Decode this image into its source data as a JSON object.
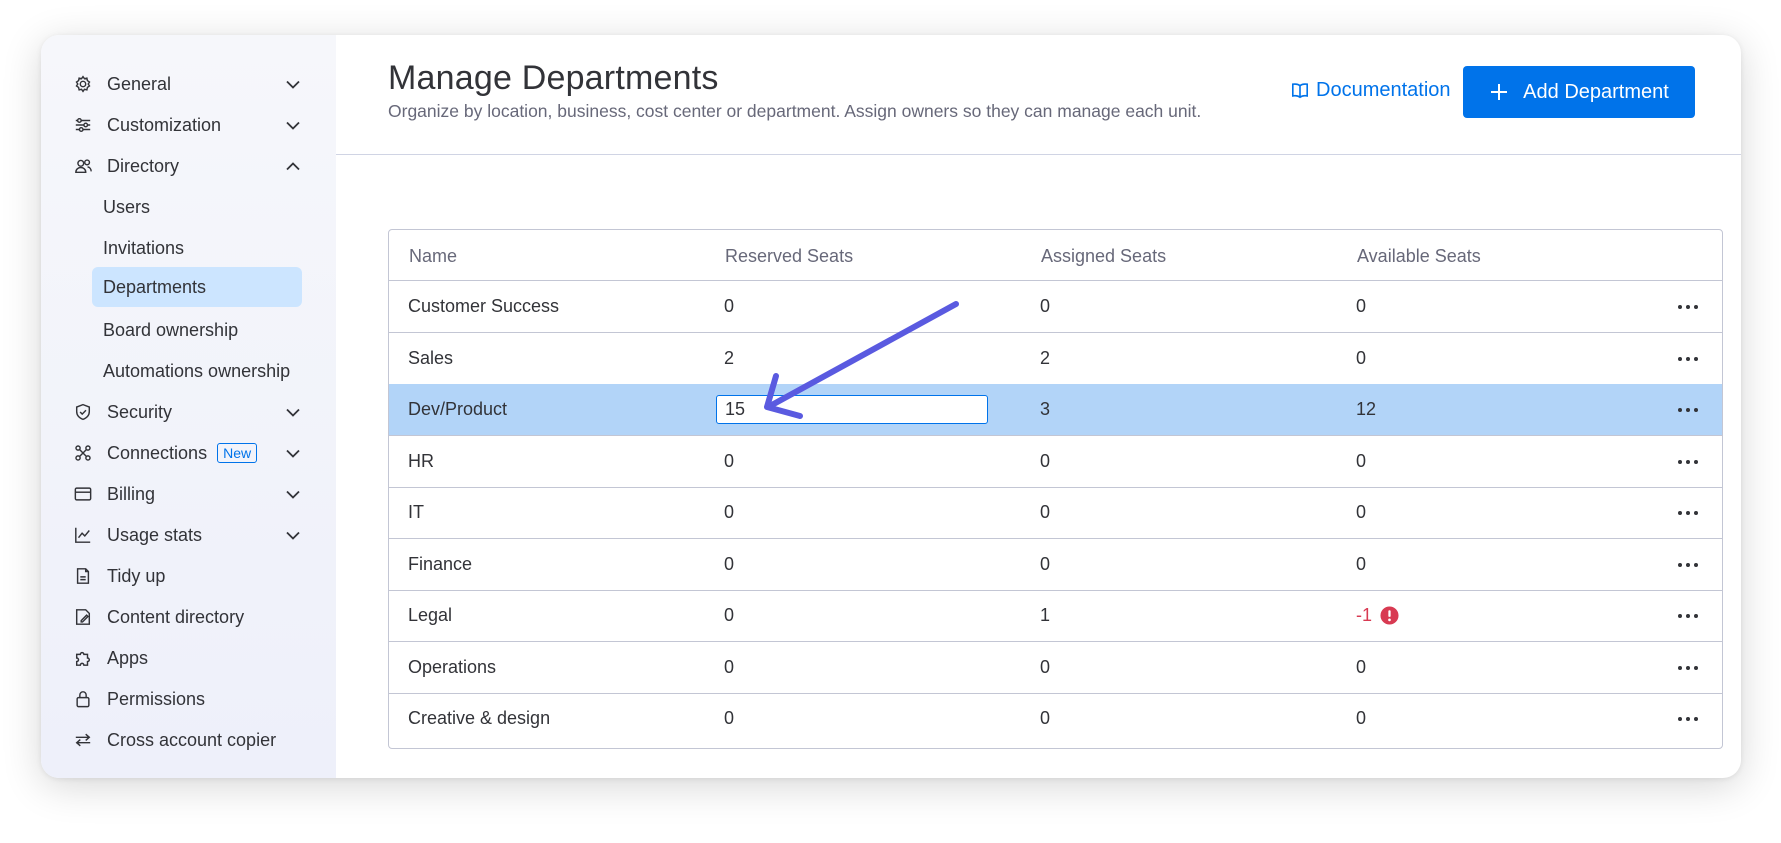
{
  "sidebar": {
    "items": [
      {
        "label": "General",
        "icon": "gear-icon",
        "expand": "down"
      },
      {
        "label": "Customization",
        "icon": "sliders-icon",
        "expand": "down"
      },
      {
        "label": "Directory",
        "icon": "users-icon",
        "expand": "up"
      },
      {
        "label": "Security",
        "icon": "shield-icon",
        "expand": "down"
      },
      {
        "label": "Connections",
        "icon": "connections-icon",
        "expand": "down",
        "badge": "New"
      },
      {
        "label": "Billing",
        "icon": "credit-card-icon",
        "expand": "down"
      },
      {
        "label": "Usage stats",
        "icon": "chart-icon",
        "expand": "down"
      },
      {
        "label": "Tidy up",
        "icon": "broom-icon"
      },
      {
        "label": "Content directory",
        "icon": "content-directory-icon"
      },
      {
        "label": "Apps",
        "icon": "puzzle-icon"
      },
      {
        "label": "Permissions",
        "icon": "lock-icon"
      },
      {
        "label": "Cross account copier",
        "icon": "swap-arrows-icon"
      }
    ],
    "directory_subitems": [
      {
        "label": "Users"
      },
      {
        "label": "Invitations"
      },
      {
        "label": "Departments",
        "active": true
      },
      {
        "label": "Board ownership"
      },
      {
        "label": "Automations ownership"
      }
    ]
  },
  "header": {
    "title": "Manage Departments",
    "subtitle": "Organize by location, business, cost center or department. Assign owners so they can manage each unit.",
    "doc_link": "Documentation",
    "add_button": "Add Department"
  },
  "table": {
    "columns": [
      "Name",
      "Reserved Seats",
      "Assigned Seats",
      "Available Seats"
    ],
    "rows": [
      {
        "name": "Customer Success",
        "reserved": "0",
        "assigned": "0",
        "available": "0"
      },
      {
        "name": "Sales",
        "reserved": "2",
        "assigned": "2",
        "available": "0"
      },
      {
        "name": "Dev/Product",
        "reserved": "15",
        "assigned": "3",
        "available": "12",
        "selected": true,
        "editing": true
      },
      {
        "name": "HR",
        "reserved": "0",
        "assigned": "0",
        "available": "0"
      },
      {
        "name": "IT",
        "reserved": "0",
        "assigned": "0",
        "available": "0"
      },
      {
        "name": "Finance",
        "reserved": "0",
        "assigned": "0",
        "available": "0"
      },
      {
        "name": "Legal",
        "reserved": "0",
        "assigned": "1",
        "available": "-1",
        "warning": true
      },
      {
        "name": "Operations",
        "reserved": "0",
        "assigned": "0",
        "available": "0"
      },
      {
        "name": "Creative & design",
        "reserved": "0",
        "assigned": "0",
        "available": "0"
      }
    ]
  },
  "colors": {
    "accent": "#0073ea",
    "selected_row": "#b2d4f8",
    "active_nav": "#cce5ff",
    "error": "#d83a52",
    "annotation_arrow": "#5a5ae0"
  }
}
